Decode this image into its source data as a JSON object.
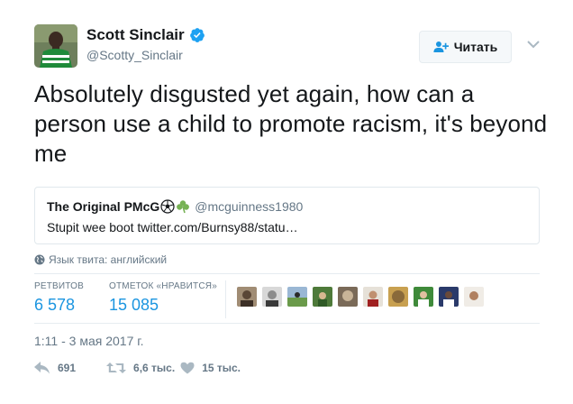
{
  "author": {
    "name": "Scott Sinclair",
    "handle": "@Scotty_Sinclair",
    "verified": true
  },
  "follow_button": {
    "label": "Читать",
    "icon": "add-user-icon"
  },
  "tweet": {
    "text": "Absolutely disgusted yet again, how can a person use a child to promote racism, it's beyond me"
  },
  "quoted_tweet": {
    "name": "The Original PMcG",
    "emojis": [
      "soccer-ball-icon",
      "shamrock-icon"
    ],
    "handle": "@mcguinness1980",
    "text": "Stupit wee boot twitter.com/Burnsy88/statu…"
  },
  "language": {
    "label": "Язык твита: английский",
    "icon": "globe-icon"
  },
  "stats": {
    "retweets_label": "РЕТВИТОВ",
    "retweets_value": "6 578",
    "likes_label": "ОТМЕТОК «НРАВИТСЯ»",
    "likes_value": "15 085"
  },
  "likers_count_shown": 10,
  "date": "1:11 - 3 мая 2017 г.",
  "actions": {
    "reply_count": "691",
    "retweet_count": "6,6 тыс.",
    "like_count": "15 тыс."
  },
  "colors": {
    "accent": "#1b95e0",
    "text": "#14171a",
    "muted": "#657786",
    "border": "#e6ecf0",
    "action_icon": "#aab8c2"
  }
}
